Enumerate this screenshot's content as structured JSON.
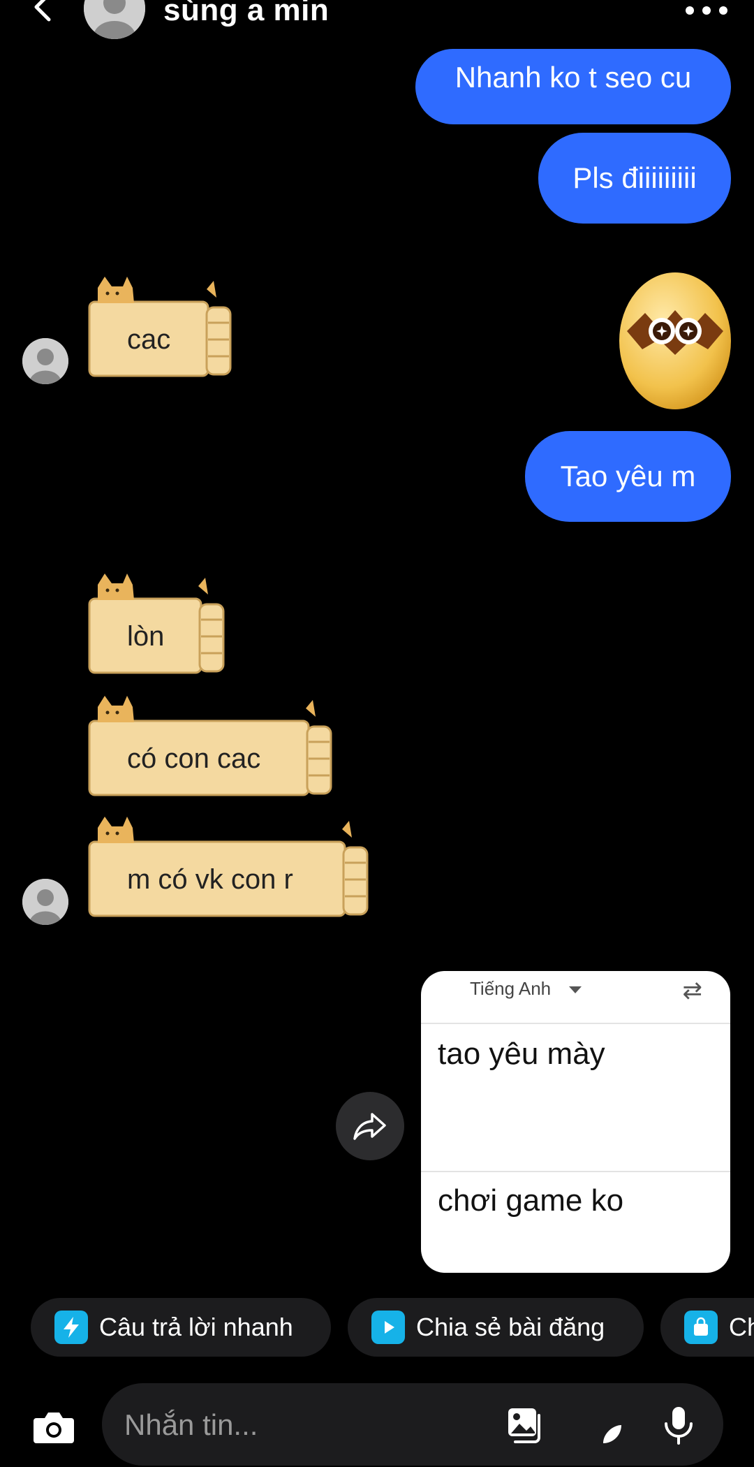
{
  "header": {
    "back_icon": "chevron-left-icon",
    "avatar_icon": "default-avatar-icon",
    "title": "sùng a min",
    "more_icon": "more-horizontal-icon"
  },
  "messages": {
    "out1": "Nhanh ko t seo cu",
    "out2": "Pls điiiiiiiii",
    "sticker_egg_icon": "egg-sticker-icon",
    "out3": "Tao yêu m",
    "doge1": "cac",
    "doge2": "lòn",
    "doge3": "có con cac",
    "doge4": "m có vk con r"
  },
  "translate_card": {
    "language": "Tiếng Anh",
    "swap_icon": "swap-arrows-icon",
    "source_text": "tao yêu mày",
    "result_text": "chơi game ko"
  },
  "share_icon": "share-forward-icon",
  "chips": [
    {
      "label": "Câu trả lời nhanh",
      "icon": "lightning-icon"
    },
    {
      "label": "Chia sẻ bài đăng",
      "icon": "play-icon"
    },
    {
      "label": "Ch",
      "icon": "shopping-bag-icon"
    }
  ],
  "composer": {
    "placeholder": "Nhắn tin...",
    "camera_icon": "camera-icon",
    "gallery_icon": "gallery-icon",
    "sticker_icon": "sticker-icon",
    "mic_icon": "microphone-icon"
  },
  "colors": {
    "background": "#000000",
    "outgoing_bubble": "#2f6bff",
    "chip_bg": "#1c1c1e",
    "chip_icon": "#16b2e8",
    "sticker_fill": "#f4d9a0"
  }
}
